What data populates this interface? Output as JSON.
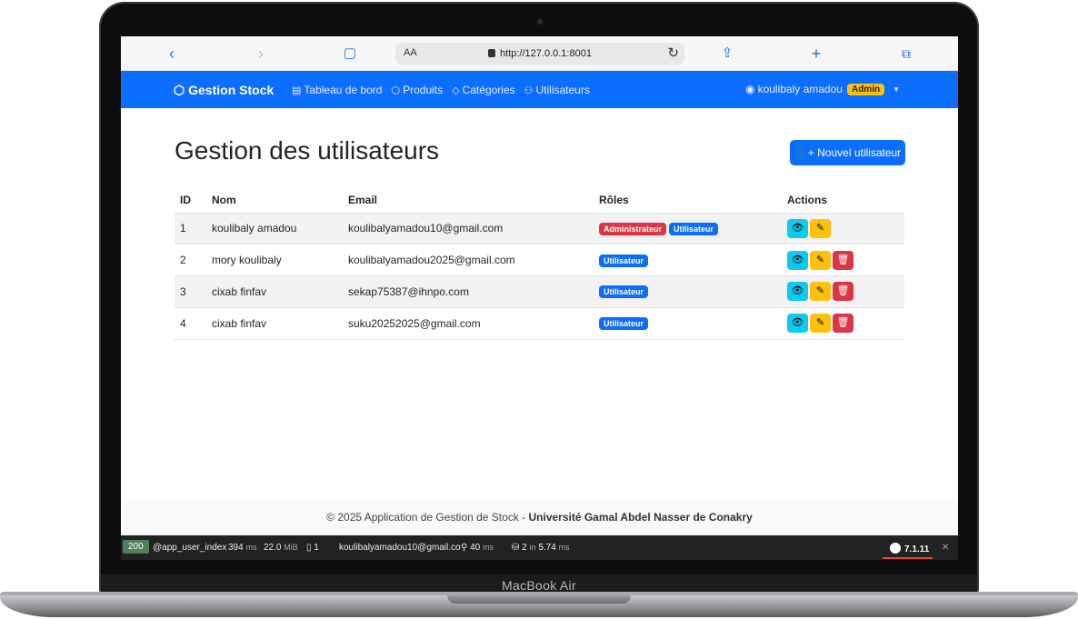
{
  "device": {
    "label": "MacBook Air"
  },
  "browser": {
    "aa_label": "AA",
    "url": "http://127.0.0.1:8001",
    "icons": [
      "back-icon",
      "forward-icon",
      "book-icon",
      "reload-icon",
      "share-icon",
      "plus-icon",
      "tabs-icon"
    ]
  },
  "navbar": {
    "brand": "Gestion Stock",
    "links": [
      {
        "label": "Tableau de bord",
        "icon": "dashboard-icon"
      },
      {
        "label": "Produits",
        "icon": "box-icon"
      },
      {
        "label": "Catégories",
        "icon": "tag-icon"
      },
      {
        "label": "Utilisateurs",
        "icon": "users-icon"
      }
    ],
    "user_name": "koulibaly amadou",
    "user_badge": "Admin"
  },
  "page": {
    "title": "Gestion des utilisateurs",
    "new_button": "Nouvel utilisateur"
  },
  "table": {
    "headers": [
      "ID",
      "Nom",
      "Email",
      "Rôles",
      "Actions"
    ],
    "rows": [
      {
        "id": "1",
        "name": "koulibaly amadou",
        "email": "koulibalyamadou10@gmail.com",
        "roles": [
          "Administrateur",
          "Utilisateur"
        ]
      },
      {
        "id": "2",
        "name": "mory koulibaly",
        "email": "koulibalyamadou2025@gmail.com",
        "roles": [
          "Utilisateur"
        ]
      },
      {
        "id": "3",
        "name": "cixab finfav",
        "email": "sekap75387@ihnpo.com",
        "roles": [
          "Utilisateur"
        ]
      },
      {
        "id": "4",
        "name": "cixab finfav",
        "email": "suku20252025@gmail.com",
        "roles": [
          "Utilisateur"
        ]
      }
    ]
  },
  "footer": {
    "text": "© 2025 Application de Gestion de Stock - ",
    "bold": "Université Gamal Abdel Nasser de Conakry"
  },
  "debug_toolbar": {
    "status": "200",
    "route": "@app_user_index",
    "time": "394",
    "time_unit": "ms",
    "memory": "22.0",
    "memory_unit": "MiB",
    "forms": "1",
    "user": "koulibalyamadou10@gmail.co",
    "events": "40",
    "events_unit": "ms",
    "queries": "2",
    "queries_in": "in",
    "queries_time": "5.74",
    "queries_unit": "ms",
    "version": "7.1.11"
  },
  "colors": {
    "primary": "#0d6efd",
    "danger": "#dc3545",
    "warning": "#ffc107",
    "info": "#0dcaf0"
  }
}
